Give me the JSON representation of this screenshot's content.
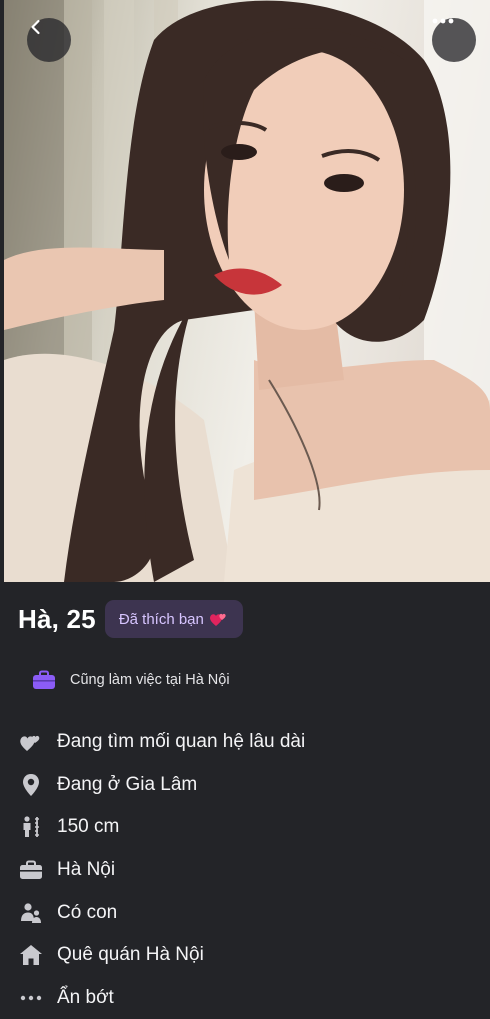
{
  "profile": {
    "name_age": "Hà, 25",
    "liked_badge": "Đã thích bạn",
    "common": "Cũng làm việc tại Hà Nội"
  },
  "details": [
    {
      "icon": "hearts-icon",
      "text": "Đang tìm mối quan hệ lâu dài"
    },
    {
      "icon": "location-pin-icon",
      "text": "Đang ở Gia Lâm"
    },
    {
      "icon": "height-icon",
      "text": "150 cm"
    },
    {
      "icon": "briefcase-icon",
      "text": "Hà Nội"
    },
    {
      "icon": "family-icon",
      "text": "Có con"
    },
    {
      "icon": "home-icon",
      "text": "Quê quán Hà Nội"
    }
  ],
  "collapse_label": "Ẩn bớt",
  "colors": {
    "background": "#232428",
    "badge_bg": "#3d3450",
    "badge_text": "#d7c5ff",
    "accent_purple": "#8b5cf6",
    "heart": "#e0245e"
  }
}
